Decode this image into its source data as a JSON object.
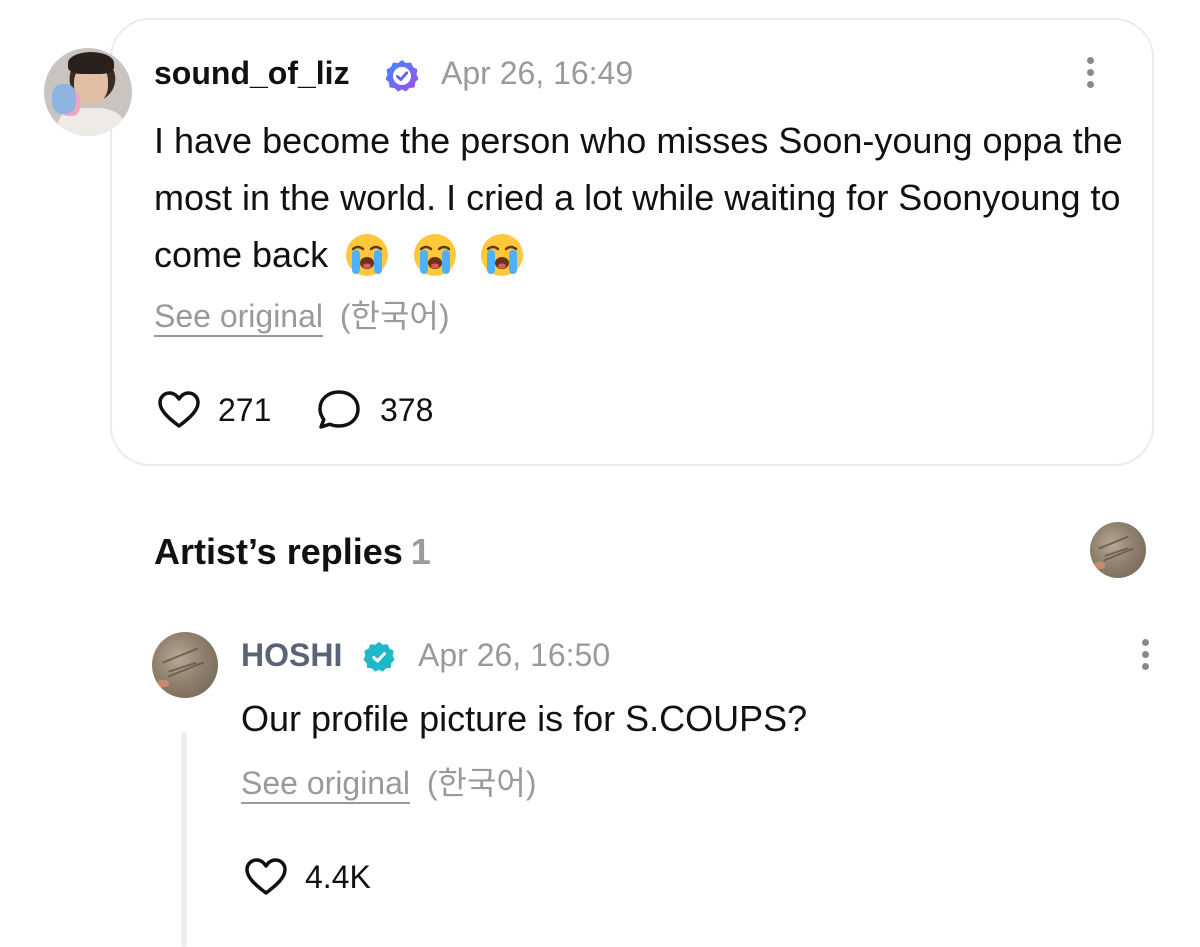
{
  "post": {
    "username": "sound_of_liz",
    "timestamp": "Apr 26, 16:49",
    "text": "I have become the person who misses Soon-young oppa the most in the world. I cried a lot while waiting for Soonyoung to come back",
    "emoji_icons": [
      "loudly-crying-face-icon",
      "loudly-crying-face-icon",
      "loudly-crying-face-icon"
    ],
    "see_original_label": "See original",
    "language_label": "(한국어)",
    "like_count": "271",
    "comment_count": "378",
    "badge_color": "#6b5cf0"
  },
  "artist_replies": {
    "title": "Artist’s replies",
    "count": "1"
  },
  "reply": {
    "username": "HOSHI",
    "timestamp": "Apr 26, 16:50",
    "text": "Our profile picture is for S.COUPS?",
    "see_original_label": "See original",
    "language_label": "(한국어)",
    "like_count": "4.4K",
    "badge_color": "#1fb8c9"
  }
}
